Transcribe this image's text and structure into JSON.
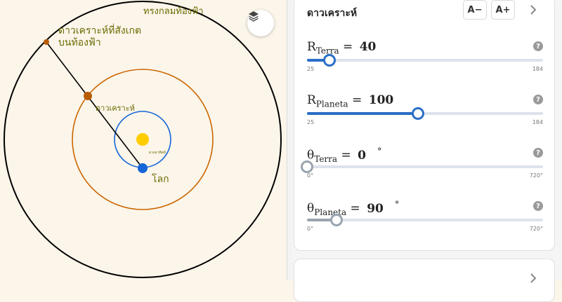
{
  "canvas": {
    "sky_label": "ทรงกลมท้องฟ้า",
    "observed_label_line1": "ดาวเคราะห์ที่สังเกต",
    "observed_label_line2": "บนท้องฟ้า",
    "planet_label": "ดาวเคราะห์",
    "sun_label": "ดวงอาทิตย์",
    "earth_label": "โลก",
    "layers_icon": "layers-icon",
    "colors": {
      "sky_circle": "#000000",
      "planet_orbit": "#cc6600",
      "earth_orbit": "#1565d8",
      "sun": "#ffcc00",
      "earth": "#1565d8",
      "planet": "#b85c00",
      "label": "#6b6b00"
    }
  },
  "panel": {
    "title": "ดาวเคราะห์",
    "zoom_out": "A−",
    "zoom_in": "A+",
    "help_glyph": "?",
    "sliders": [
      {
        "sym": "R",
        "sub": "Terra",
        "eq": "=",
        "value": "40",
        "unit": "",
        "min": "25",
        "max": "184",
        "vmin": 25,
        "vmax": 184,
        "v": 40,
        "color": "#2a6ec6"
      },
      {
        "sym": "R",
        "sub": "Planeta",
        "eq": "=",
        "value": "100",
        "unit": "",
        "min": "25",
        "max": "184",
        "vmin": 25,
        "vmax": 184,
        "v": 100,
        "color": "#2a6ec6"
      },
      {
        "sym": "θ",
        "sub": "Terra",
        "eq": "=",
        "value": "0",
        "unit": "°",
        "min": "0°",
        "max": "720°",
        "vmin": 0,
        "vmax": 720,
        "v": 0,
        "color": "#9aa4b0"
      },
      {
        "sym": "θ",
        "sub": "Planeta",
        "eq": "=",
        "value": "90",
        "unit": "°",
        "min": "0°",
        "max": "720°",
        "vmin": 0,
        "vmax": 720,
        "v": 90,
        "color": "#9aa4b0"
      }
    ]
  }
}
